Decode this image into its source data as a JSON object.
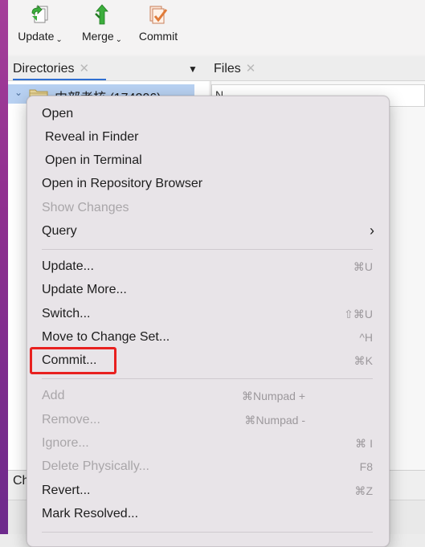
{
  "toolbar": {
    "update": {
      "label": "Update",
      "chevron": "⌄"
    },
    "merge": {
      "label": "Merge",
      "chevron": "⌄"
    },
    "commit": {
      "label": "Commit"
    }
  },
  "tabs": {
    "directories": "Directories",
    "files": "Files",
    "close": "✕",
    "dropdown": "▼"
  },
  "directory": {
    "disclosure": "⌄",
    "label": "内部考核 (174206)"
  },
  "files": {
    "search_value": "N"
  },
  "bottom": {
    "label": "Ch"
  },
  "menu": {
    "items": [
      {
        "label": "Open",
        "shortcut": "",
        "disabled": false
      },
      {
        "label": "Reveal in Finder",
        "shortcut": "",
        "disabled": false
      },
      {
        "label": "Open in Terminal",
        "shortcut": "",
        "disabled": false
      },
      {
        "label": "Open in Repository Browser",
        "shortcut": "",
        "disabled": false
      },
      {
        "label": "Show Changes",
        "shortcut": "",
        "disabled": true
      },
      {
        "label": "Query",
        "shortcut": "",
        "disabled": false,
        "submenu_arrow": "›"
      },
      {
        "label": "Update...",
        "shortcut": "⌘U",
        "disabled": false
      },
      {
        "label": "Update More...",
        "shortcut": "",
        "disabled": false
      },
      {
        "label": "Switch...",
        "shortcut": "⇧⌘U",
        "disabled": false
      },
      {
        "label": "Move to Change Set...",
        "shortcut": "^H",
        "disabled": false
      },
      {
        "label": "Commit...",
        "shortcut": "⌘K",
        "disabled": false
      },
      {
        "label": "Add",
        "shortcut": "⌘Numpad +",
        "disabled": true
      },
      {
        "label": "Remove...",
        "shortcut": "⌘Numpad -",
        "disabled": true
      },
      {
        "label": "Ignore...",
        "shortcut": "⌘ I",
        "disabled": true
      },
      {
        "label": "Delete Physically...",
        "shortcut": "F8",
        "disabled": true
      },
      {
        "label": "Revert...",
        "shortcut": "⌘Z",
        "disabled": false
      },
      {
        "label": "Mark Resolved...",
        "shortcut": "",
        "disabled": false
      }
    ]
  },
  "colors": {
    "highlight_box": "#e8201f",
    "selection": "#b8d1f2",
    "active_tab_underline": "#2f6fd1"
  }
}
